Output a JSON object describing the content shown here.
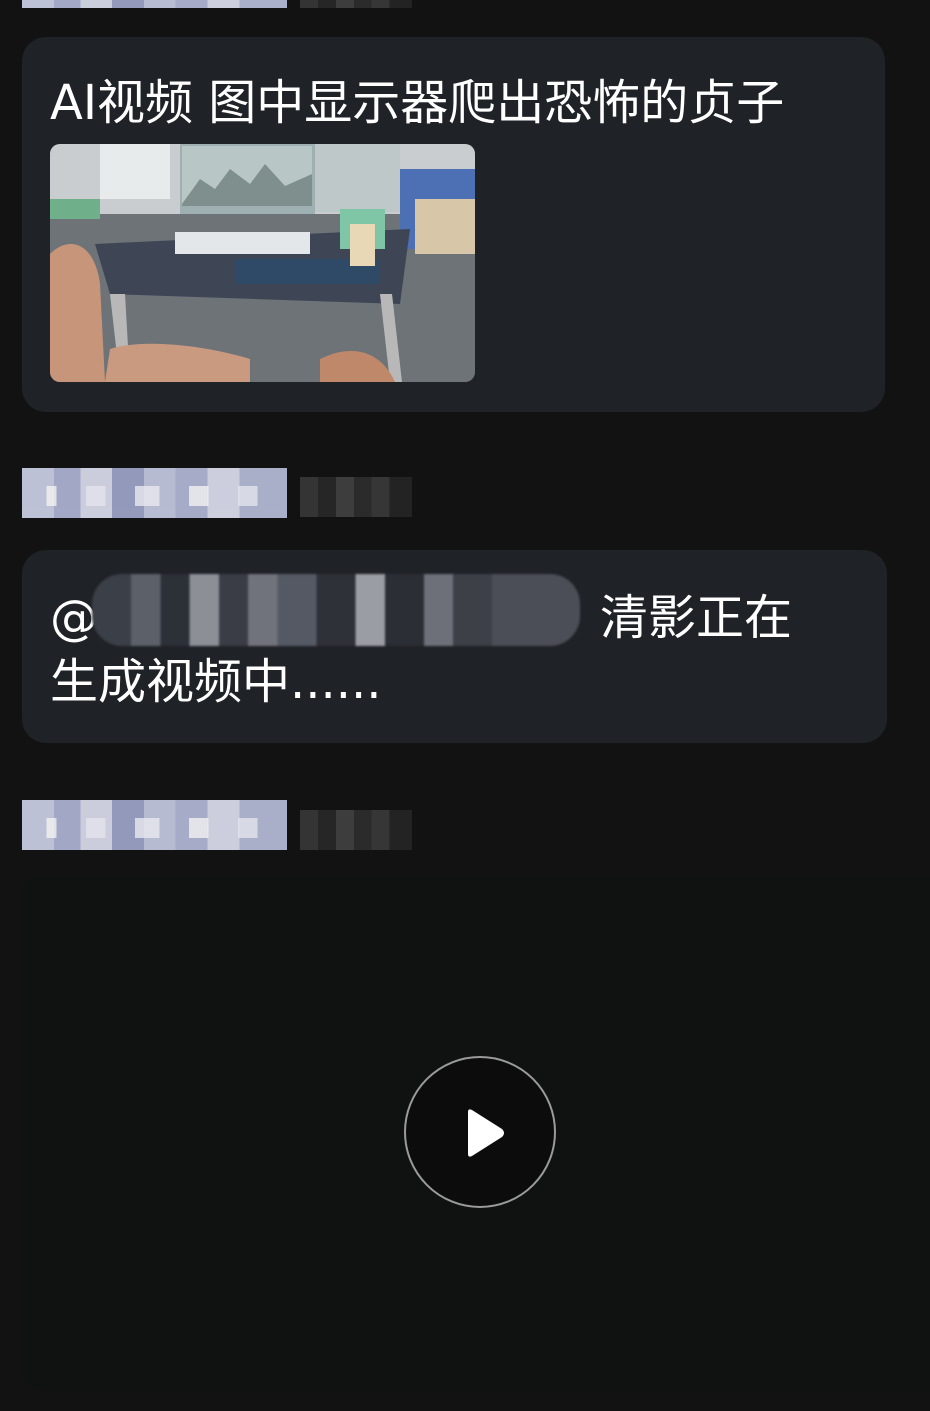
{
  "messages": [
    {
      "text": "AI视频 图中显示器爬出恐怖的贞子",
      "image_alt": "photo"
    },
    {
      "mention_prefix": "@",
      "text_line1": "清影正在",
      "text_line2": "生成视频中......"
    },
    {
      "video": "video-message"
    }
  ],
  "icons": {
    "play": "play-icon"
  },
  "colors": {
    "background": "#121212",
    "bubble": "#1f2227",
    "video_bg": "#0f1211",
    "text": "#ffffff"
  }
}
